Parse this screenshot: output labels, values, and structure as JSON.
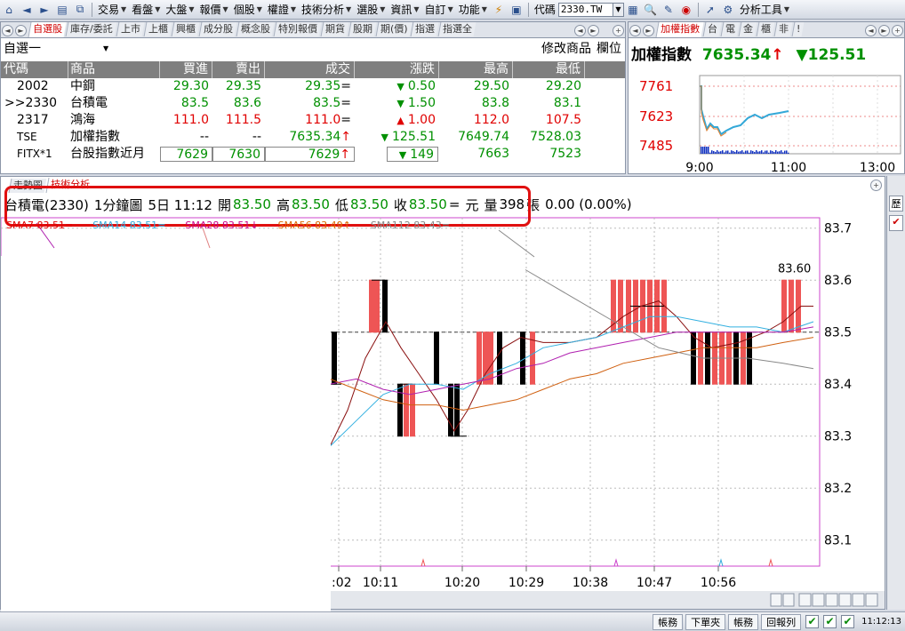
{
  "toolbar": {
    "menus": [
      "交易",
      "看盤",
      "大盤",
      "報價",
      "個股",
      "權證",
      "技術分析",
      "選股",
      "資訊",
      "自訂",
      "功能"
    ],
    "code_label": "代碼",
    "code_value": "2330.TW",
    "tools_label": "分析工具"
  },
  "watchlist": {
    "tabs": [
      "自選股",
      "庫存/委託",
      "上市",
      "上櫃",
      "興櫃",
      "成分股",
      "概念股",
      "特別報價",
      "期貨",
      "股期",
      "期(價)",
      "指選",
      "指選全"
    ],
    "group_name": "自選一",
    "modify_label": "修改商品",
    "column_label": "欄位",
    "headers": [
      "代碼",
      "商品",
      "買進",
      "賣出",
      "成交",
      "漲跌",
      "最高",
      "最低"
    ],
    "rows": [
      {
        "code": "2002",
        "name": "中鋼",
        "bid": "29.30",
        "ask": "29.35",
        "last": "29.35",
        "mark": "=",
        "arrow": "▼",
        "change": "0.50",
        "high": "29.50",
        "low": "29.20",
        "color": "green"
      },
      {
        "code": ">>2330",
        "name": "台積電",
        "bid": "83.5",
        "ask": "83.6",
        "last": "83.5",
        "mark": "=",
        "arrow": "▼",
        "change": "1.50",
        "high": "83.8",
        "low": "83.1",
        "color": "green"
      },
      {
        "code": "2317",
        "name": "鴻海",
        "bid": "111.0",
        "ask": "111.5",
        "last": "111.0",
        "mark": "=",
        "arrow": "▲",
        "change": "1.00",
        "high": "112.0",
        "low": "107.5",
        "color": "red"
      },
      {
        "code": "TSE",
        "name": "加權指數",
        "bid": "--",
        "ask": "--",
        "last": "7635.34",
        "mark": "↑",
        "arrow": "▼",
        "change": "125.51",
        "high": "7649.74",
        "low": "7528.03",
        "color": "green"
      },
      {
        "code": "FITX*1",
        "name": "台股指數近月",
        "bid": "7629",
        "ask": "7630",
        "last": "7629",
        "mark": "↑",
        "arrow": "▼",
        "change": "149",
        "high": "7663",
        "low": "7523",
        "color": "green"
      }
    ]
  },
  "index_panel": {
    "tabs": [
      "加權指數",
      "台",
      "電",
      "金",
      "櫃",
      "非",
      "!"
    ],
    "title": "加權指數",
    "value": "7635.34",
    "value_arrow": "↑",
    "change_arrow": "▼",
    "change": "125.51",
    "y_ticks": [
      "7761",
      "7623",
      "7485"
    ],
    "x_ticks": [
      "9:00",
      "11:00",
      "13:00"
    ]
  },
  "chart_panel": {
    "tabs": [
      "走勢圖",
      "技術分析"
    ],
    "info": {
      "stock": "台積電(2330)",
      "period": "1分鐘圖",
      "range": "5日 11:12",
      "open_label": "開",
      "open": "83.50",
      "high_label": "高",
      "high": "83.50",
      "low_label": "低",
      "low": "83.50",
      "close_label": "收",
      "close": "83.50",
      "close_mark": "=",
      "unit": "元",
      "volume_label": "量",
      "volume": "398",
      "volume_unit": "張",
      "change": "0.00 (0.00%)"
    },
    "ma": [
      {
        "label": "SMA7 83.51",
        "mark": "=",
        "color": "#e00000"
      },
      {
        "label": "SMA14 83.51",
        "mark": "=",
        "color": "#33aadd"
      },
      {
        "label": "SMA28 83.51",
        "mark": "↓",
        "color": "#cc0088"
      },
      {
        "label": "SMA56 83.49",
        "mark": "↑",
        "color": "#dd6600"
      },
      {
        "label": "SMA112 83.43",
        "mark": "=",
        "color": "#888888"
      }
    ],
    "peak_label": "83.60",
    "colors": {
      "up_bar": "#ee5555",
      "down_bar": "#000000",
      "border": "#cc44cc"
    }
  },
  "chart_data": {
    "type": "candlestick",
    "y_ticks": [
      "83.7",
      "83.6",
      "83.5",
      "83.4",
      "83.3",
      "83.2",
      "83.1"
    ],
    "x_ticks": [
      ":02",
      "10:11",
      "10:20",
      "10:29",
      "10:38",
      "10:47",
      "10:56"
    ],
    "ylim": [
      83.05,
      83.72
    ]
  },
  "side_strip": {
    "label": "歷"
  },
  "statusbar": {
    "buttons": [
      "帳務",
      "下單夾",
      "帳務",
      "回報列"
    ],
    "clock": "11:12:13"
  }
}
